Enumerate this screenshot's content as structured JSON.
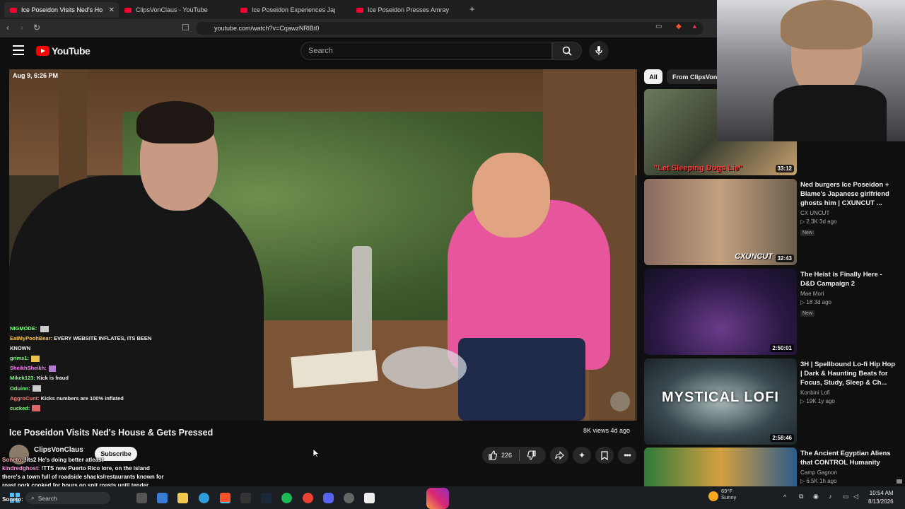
{
  "browser": {
    "tabs": [
      {
        "label": "Ice Poseidon Visits Ned's Ho",
        "active": true
      },
      {
        "label": "ClipsVonClaus - YouTube",
        "active": false
      },
      {
        "label": "Ice Poseidon Experiences Japan's Se",
        "active": false
      },
      {
        "label": "Ice Poseidon Presses Amray & Tries t",
        "active": false
      }
    ],
    "new_tab": "+",
    "url": "youtube.com/watch?v=CqawzNRlBt0"
  },
  "header": {
    "logo": "YouTube",
    "search_placeholder": "Search"
  },
  "video": {
    "timestamp": "Aug 9, 6:26 PM",
    "chat": [
      {
        "user": "NIGMODE:",
        "text": "",
        "color": "#7fff7f"
      },
      {
        "user": "EatMyPoohBear:",
        "text": "EVERY WEBSITE INFLATES, ITS BEEN",
        "color": "#ffc04d"
      },
      {
        "user": "",
        "text": "KNOWN",
        "color": "#ffffff"
      },
      {
        "user": "grims1:",
        "text": "",
        "color": "#7fff7f"
      },
      {
        "user": "SheikhSheikh:",
        "text": "",
        "color": "#ff7fff"
      },
      {
        "user": "Mikek123:",
        "text": "Kick is fraud",
        "color": "#7fff7f"
      },
      {
        "user": "Oduinn:",
        "text": "",
        "color": "#7fff7f"
      },
      {
        "user": "AggroCunt:",
        "text": "Kicks numbers are 100% inflated",
        "color": "#ff7f7f"
      },
      {
        "user": "cucked:",
        "text": "",
        "color": "#7fff7f"
      }
    ]
  },
  "below": {
    "title": "Ice Poseidon Visits Ned's House & Gets Pressed",
    "views": "8K views  4d ago",
    "channel": "ClipsVonClaus",
    "subscribe": "Subscribe",
    "likes": "226"
  },
  "overlay_chat": [
    {
      "user": "Soneto:",
      "text": "!its2 He's doing better atleast"
    },
    {
      "user": "kindredghost:",
      "text": "!TTS new Puerto Rico lore, on the island"
    },
    {
      "user": "",
      "text": "there's a town full of roadside shacks/restaurants known for"
    },
    {
      "user": "",
      "text": "roast pork cooked for hours on spit roasts until tender"
    },
    {
      "user": "Soneto:",
      "text": ""
    }
  ],
  "sidebar": {
    "chips": [
      "All",
      "From ClipsVonC"
    ],
    "recommendations": [
      {
        "title": "",
        "channel": "",
        "meta": "",
        "badge": "",
        "duration": "33:12",
        "caption": "\"Let Sleeping Dogs Lie\""
      },
      {
        "title": "Ned burgers Ice Poseidon + Blame's Japanese girlfriend ghosts him | CXUNCUT ...",
        "channel": "CX UNCUT",
        "meta": "2.3K  3d ago",
        "badge": "New",
        "duration": "32:43",
        "caption": "CXUNCUT"
      },
      {
        "title": "The Heist is Finally Here - D&D Campaign 2",
        "channel": "Mae Mori",
        "meta": "18  3d ago",
        "badge": "New",
        "duration": "2:50:01",
        "caption": ""
      },
      {
        "title": "3H | Spellbound Lo-fi Hip Hop | Dark & Haunting Beats for Focus, Study, Sleep & Ch...",
        "channel": "Konbini Lofi",
        "meta": "19K  1y ago",
        "badge": "",
        "duration": "2:58:46",
        "caption": "MYSTICAL LOFI"
      },
      {
        "title": "The Ancient Egyptian Aliens that CONTROL Humanity",
        "channel": "Camp Gagnon",
        "meta": "6.5K  1h ago",
        "badge": "",
        "duration": "",
        "caption": ""
      }
    ]
  },
  "taskbar": {
    "search": "Search",
    "weather_temp": "69°F",
    "weather_desc": "Sunny",
    "time": "10:54 AM",
    "date": "8/13/2026",
    "overlay_user": "Soneto:"
  }
}
